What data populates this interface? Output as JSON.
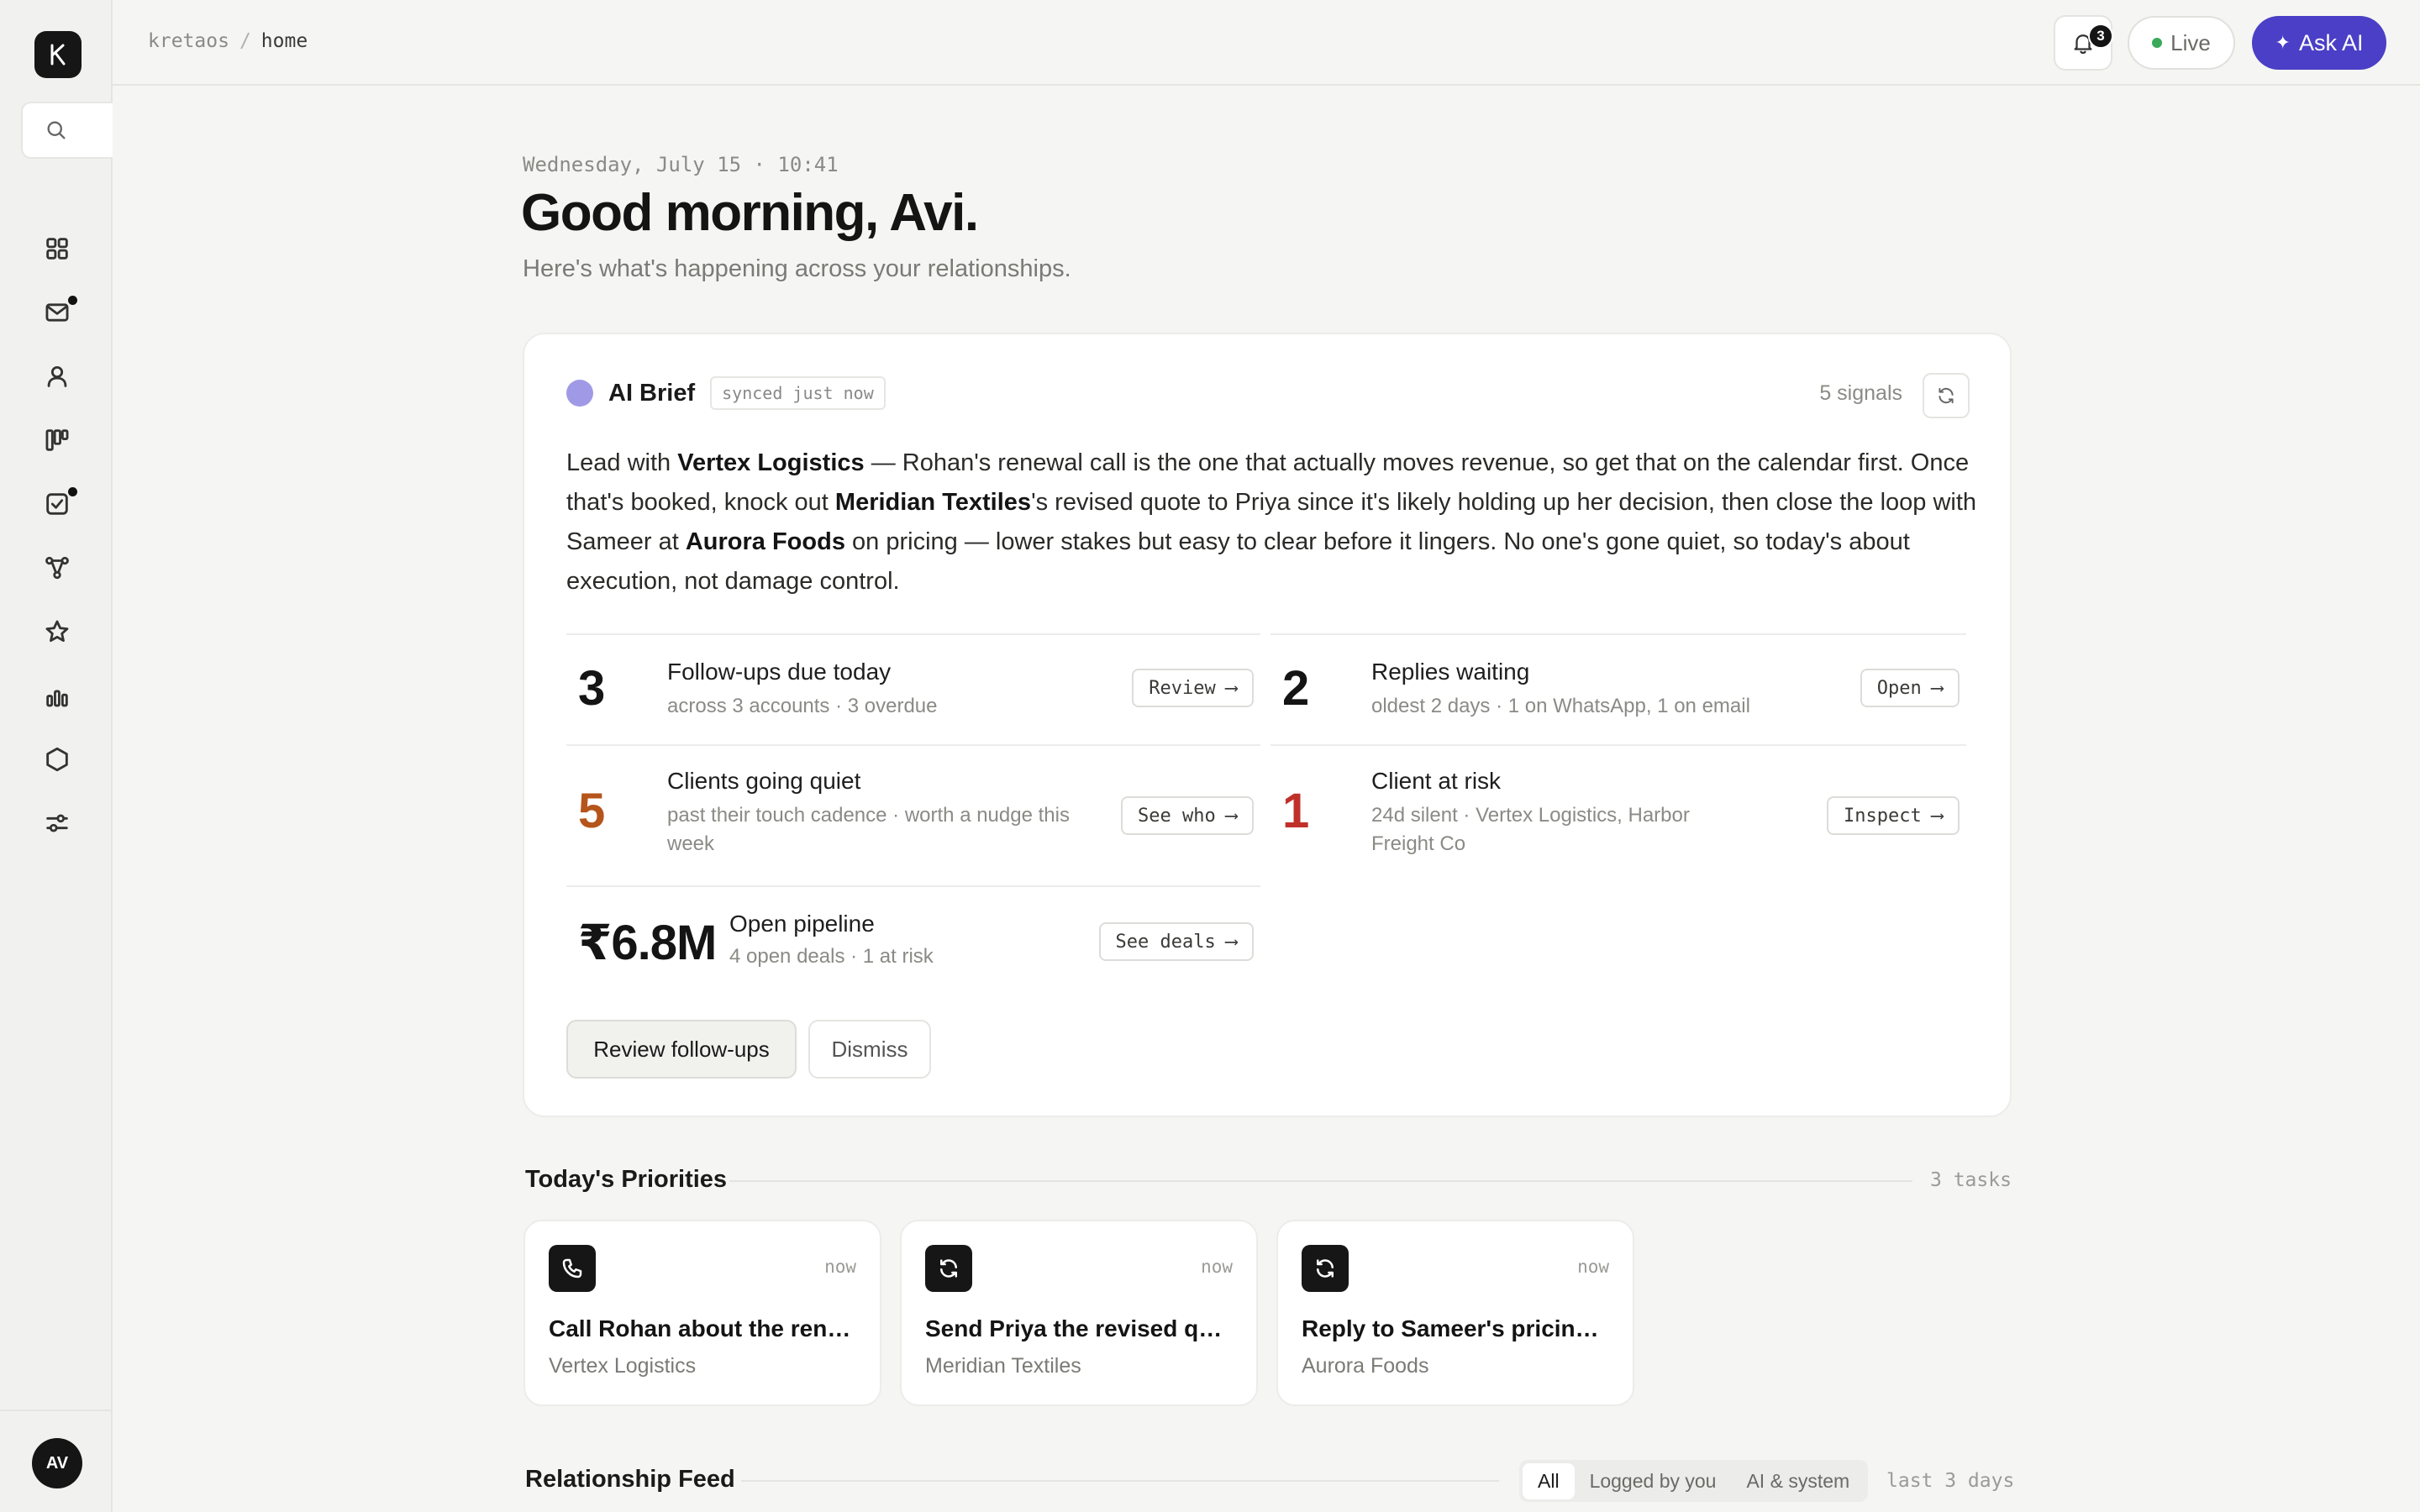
{
  "app": {
    "logo_letter": "K",
    "user_initials": "AV"
  },
  "breadcrumb": {
    "root": "kretaos",
    "separator": "/",
    "current": "home"
  },
  "topbar": {
    "notification_count": "3",
    "live_label": "Live",
    "ask_ai_label": "Ask AI",
    "ask_ai_icon": "✦"
  },
  "sidebar": {
    "items": [
      {
        "name": "dashboard-icon",
        "dot": false
      },
      {
        "name": "mail-icon",
        "dot": true
      },
      {
        "name": "contacts-icon",
        "dot": false
      },
      {
        "name": "pipeline-icon",
        "dot": false
      },
      {
        "name": "tasks-icon",
        "dot": true
      },
      {
        "name": "graph-icon",
        "dot": false
      },
      {
        "name": "star-icon",
        "dot": false
      },
      {
        "name": "analytics-icon",
        "dot": false
      },
      {
        "name": "hexagon-icon",
        "dot": false
      },
      {
        "name": "settings-sliders-icon",
        "dot": false
      }
    ]
  },
  "header": {
    "date": "Wednesday, July 15 · 10:41",
    "greeting": "Good morning, Avi.",
    "subtitle": "Here's what's happening across your relationships."
  },
  "brief": {
    "title": "AI Brief",
    "sync_status": "synced just now",
    "signals": "5 signals",
    "text": {
      "p1": "Lead with ",
      "b1": "Vertex Logistics",
      "p2": " — Rohan's renewal call is the one that actually moves revenue, so get that on the calendar first. Once that's booked, knock out ",
      "b2": "Meridian Textiles",
      "p3": "'s revised quote to Priya since it's likely holding up her decision, then close the loop with Sameer at ",
      "b3": "Aurora Foods",
      "p4": " on pricing — lower stakes but easy to clear before it lingers. No one's gone quiet, so today's about execution, not damage control."
    },
    "stats": [
      {
        "value": "3",
        "label": "Follow-ups due today",
        "desc": "across 3 accounts · 3 overdue",
        "action": "Review",
        "color": "#141414"
      },
      {
        "value": "2",
        "label": "Replies waiting",
        "desc": "oldest 2 days · 1 on WhatsApp, 1 on email",
        "action": "Open",
        "color": "#141414"
      },
      {
        "value": "5",
        "label": "Clients going quiet",
        "desc": "past their touch cadence · worth a nudge this week",
        "action": "See who",
        "color": "#b5541b"
      },
      {
        "value": "1",
        "label": "Client at risk",
        "desc": "24d silent · Vertex Logistics, Harbor Freight Co",
        "action": "Inspect",
        "color": "#c0302b"
      },
      {
        "value": "₹6.8M",
        "label": "Open pipeline",
        "desc": "4 open deals · 1 at risk",
        "action": "See deals",
        "color": "#141414"
      }
    ],
    "arrow": "⟶",
    "primary_action": "Review follow-ups",
    "secondary_action": "Dismiss"
  },
  "priorities": {
    "title": "Today's Priorities",
    "count": "3 tasks",
    "tasks": [
      {
        "icon": "phone-icon",
        "time": "now",
        "title": "Call Rohan about the renewal",
        "client": "Vertex Logistics"
      },
      {
        "icon": "refresh-icon",
        "time": "now",
        "title": "Send Priya the revised quote",
        "client": "Meridian Textiles"
      },
      {
        "icon": "refresh-icon",
        "time": "now",
        "title": "Reply to Sameer's pricing question",
        "client": "Aurora Foods"
      }
    ]
  },
  "feed": {
    "title": "Relationship Feed",
    "tabs": [
      "All",
      "Logged by you",
      "AI & system"
    ],
    "active_tab": "All",
    "range": "last 3 days"
  }
}
